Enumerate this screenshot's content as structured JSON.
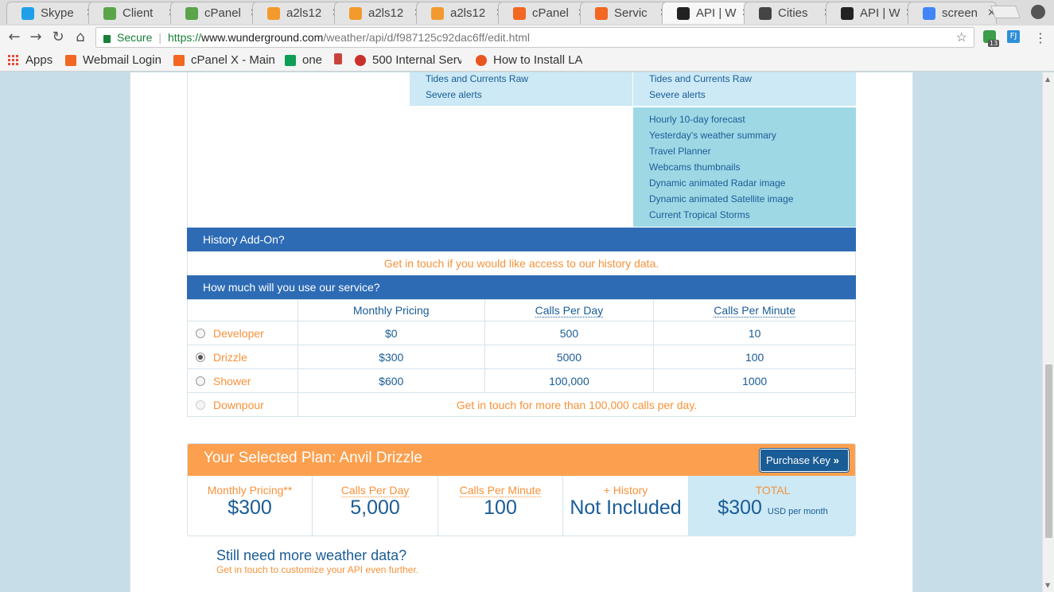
{
  "browser": {
    "tabs": [
      {
        "title": "Skype",
        "icon": "skype-icon",
        "color": "#1ea0e8"
      },
      {
        "title": "Client",
        "icon": "client-icon",
        "color": "#5aa54a"
      },
      {
        "title": "cPanel",
        "icon": "cpanel-icon",
        "color": "#5aa54a"
      },
      {
        "title": "a2ls12",
        "icon": "phpmyadmin-icon",
        "color": "#f29a2e"
      },
      {
        "title": "a2ls12",
        "icon": "phpmyadmin-icon",
        "color": "#f29a2e"
      },
      {
        "title": "a2ls12",
        "icon": "phpmyadmin-icon",
        "color": "#f29a2e"
      },
      {
        "title": "cPanel",
        "icon": "cpanel-icon",
        "color": "#f26722"
      },
      {
        "title": "Servic",
        "icon": "cpanel-icon",
        "color": "#f26722"
      },
      {
        "title": "API | W",
        "icon": "wunderground-icon",
        "color": "#222"
      },
      {
        "title": "Cities",
        "icon": "compass-icon",
        "color": "#444"
      },
      {
        "title": "API | W",
        "icon": "wunderground-icon",
        "color": "#222"
      },
      {
        "title": "screen",
        "icon": "google-icon",
        "color": "#4285f4"
      }
    ],
    "active_tab": 8,
    "secure_label": "Secure",
    "url_scheme": "https://",
    "url_host": "www.wunderground.com",
    "url_path": "/weather/api/d/f987125c92dac6ff/edit.html",
    "extension_badge": "13",
    "extension2_label": "FJ"
  },
  "bookmarks": [
    {
      "label": "Apps"
    },
    {
      "label": "Webmail Login"
    },
    {
      "label": "cPanel X - Main"
    },
    {
      "label": "one"
    },
    {
      "label": ""
    },
    {
      "label": "500 Internal Serv"
    },
    {
      "label": "How to Install LA"
    }
  ],
  "features": {
    "col2": [
      "Tides and Currents Raw",
      "Severe alerts"
    ],
    "col3": [
      "Tides and Currents Raw",
      "Severe alerts"
    ],
    "col3_extra": [
      "Hourly 10-day forecast",
      "Yesterday's weather summary",
      "Travel Planner",
      "Webcams thumbnails",
      "Dynamic animated Radar image",
      "Dynamic animated Satellite image",
      "Current Tropical Storms"
    ]
  },
  "history": {
    "heading": "History Add-On?",
    "note": "Get in touch if you would like access to our history data."
  },
  "usage": {
    "heading": "How much will you use our service?",
    "columns": [
      "Monthly Pricing",
      "Calls Per Day",
      "Calls Per Minute"
    ],
    "plans": [
      {
        "name": "Developer",
        "price": "$0",
        "per_day": "500",
        "per_minute": "10"
      },
      {
        "name": "Drizzle",
        "price": "$300",
        "per_day": "5000",
        "per_minute": "100"
      },
      {
        "name": "Shower",
        "price": "$600",
        "per_day": "100,000",
        "per_minute": "1000"
      }
    ],
    "downpour": {
      "name": "Downpour",
      "message": "Get in touch for more than 100,000 calls per day."
    },
    "selected": "Drizzle"
  },
  "selected_plan": {
    "title": "Your Selected Plan: Anvil Drizzle",
    "purchase_label": "Purchase Key",
    "monthly_label": "Monthly Pricing**",
    "monthly_value": "$300",
    "per_day_label": "Calls Per Day",
    "per_day_value": "5,000",
    "per_minute_label": "Calls Per Minute",
    "per_minute_value": "100",
    "history_label": "+ History",
    "history_value": "Not Included",
    "total_label": "TOTAL",
    "total_value": "$300",
    "total_unit": "USD per month"
  },
  "more_data": {
    "title": "Still need more weather data?",
    "subtitle": "Get in touch to customize your API even further."
  },
  "colors": {
    "accent_blue": "#2d6bb5",
    "link_blue": "#1a5c96",
    "orange": "#f7923a",
    "plan_bar": "#fca04f",
    "light_blue": "#cce9f5",
    "teal": "#9fd8e5"
  }
}
